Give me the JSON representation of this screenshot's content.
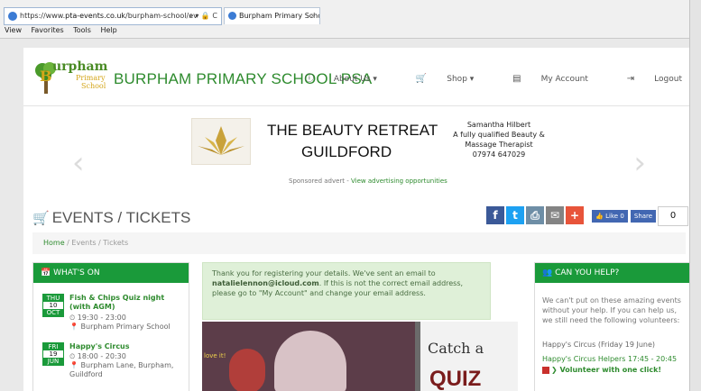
{
  "browser": {
    "url_prefix": "https://www.",
    "url_domain": "pta-events.co.uk",
    "url_rest": "/burpham-school/ev",
    "url_controls": "⌕ ▾ 🔒 C",
    "tab_title": "Burpham Primary School P...",
    "tab_close": "×",
    "menu": [
      "View",
      "Favorites",
      "Tools",
      "Help"
    ]
  },
  "site": {
    "logo_text_1": "urpham",
    "logo_text_2": "Primary",
    "logo_text_3": "School",
    "brand": "BURPHAM PRIMARY SCHOOL PSA",
    "nav": [
      {
        "icon": "ⓘ",
        "label": "About Us ▾"
      },
      {
        "icon": "🛒",
        "label": "Shop ▾"
      },
      {
        "icon": "▤",
        "label": "My Account"
      },
      {
        "icon": "⇥",
        "label": "Logout"
      }
    ]
  },
  "advert": {
    "title_line1": "THE BEAUTY RETREAT",
    "title_line2": "GUILDFORD",
    "side_text": "Samantha Hilbert\nA fully qualified Beauty &\nMassage Therapist\n07974 647029",
    "sponsored": "Sponsored advert - ",
    "sponsored_link": "View advertising opportunities",
    "prev": "‹",
    "next": "›"
  },
  "page": {
    "heading": "EVENTS / TICKETS",
    "breadcrumb_home": "Home",
    "breadcrumb_sep": " / ",
    "breadcrumb_current": "Events / Tickets"
  },
  "share": {
    "facebook": "f",
    "twitter": "t",
    "print": "⎙",
    "email": "✉",
    "more": "+",
    "like": "👍 Like 0",
    "share_label": "Share",
    "count": "0"
  },
  "whats_on": {
    "header": "📅 WHAT'S ON",
    "events": [
      {
        "day": "THU",
        "date": "10",
        "month": "OCT",
        "title": "Fish & Chips Quiz night (with AGM)",
        "time": "⏲ 19:30 - 23:00",
        "place": "📍 Burpham Primary School"
      },
      {
        "day": "FRI",
        "date": "19",
        "month": "JUN",
        "title": "Happy's Circus",
        "time": "⏲ 18:00 - 20:30",
        "place": "📍 Burpham Lane, Burpham, Guildford"
      }
    ]
  },
  "message": {
    "text_before": "Thank you for registering your details. We've sent an email to ",
    "email": "natalielennon@icloud.com",
    "text_after": ". If this is not the correct email address, please go to \"My Account\" and change your email address."
  },
  "promo": {
    "love": "love it!",
    "catch": "Catch a",
    "quiz": "QUIZ"
  },
  "help": {
    "header": "👥 CAN YOU HELP?",
    "text": "We can't put on these amazing events without your help. If you can help us, we still need the following volunteers:",
    "event": "Happy's Circus (Friday 19 June)",
    "helpers": "Happy's Circus Helpers 17:45 - 20:45",
    "volunteer": "❯ Volunteer with one click!"
  }
}
